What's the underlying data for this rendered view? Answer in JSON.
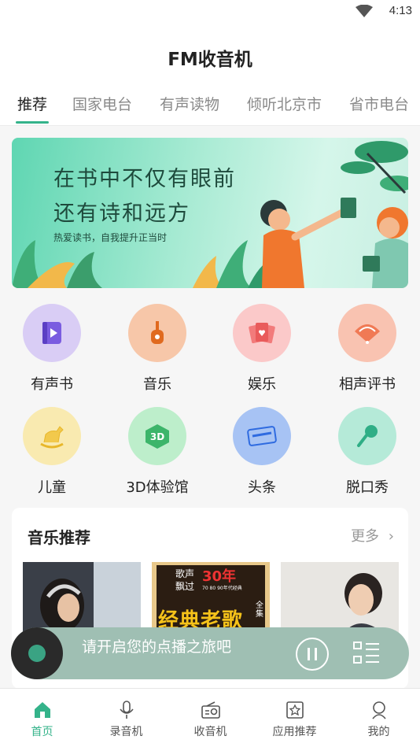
{
  "status": {
    "time": "4:13"
  },
  "header": {
    "title": "FM收音机"
  },
  "tabs": [
    {
      "label": "推荐"
    },
    {
      "label": "国家电台"
    },
    {
      "label": "有声读物"
    },
    {
      "label": "倾听北京市"
    },
    {
      "label": "省市电台"
    }
  ],
  "banner": {
    "line1": "在书中不仅有眼前",
    "line2": "还有诗和远方",
    "subtitle": "热爱读书，自我提升正当时"
  },
  "categories": [
    {
      "label": "有声书",
      "icon": "audiobook-icon",
      "color": "#d9cdf5"
    },
    {
      "label": "音乐",
      "icon": "guitar-icon",
      "color": "#f7c7a9"
    },
    {
      "label": "娱乐",
      "icon": "cards-icon",
      "color": "#fbc9c9"
    },
    {
      "label": "相声评书",
      "icon": "fan-icon",
      "color": "#f9c3b1"
    },
    {
      "label": "儿童",
      "icon": "rocking-horse-icon",
      "color": "#f9eab0"
    },
    {
      "label": "3D体验馆",
      "icon": "3d-icon",
      "color": "#bdeecb"
    },
    {
      "label": "头条",
      "icon": "news-icon",
      "color": "#a7c3f4"
    },
    {
      "label": "脱口秀",
      "icon": "microphone-icon",
      "color": "#b5ead8"
    }
  ],
  "music": {
    "title": "音乐推荐",
    "more": "更多",
    "thumb2_text1": "歌声",
    "thumb2_text2": "飘过",
    "thumb2_text3": "经典老歌",
    "thumb2_text4": "全集",
    "thumb2_year": "30年",
    "thumb2_decades": "70 80 90年代经典"
  },
  "player": {
    "text": "请开启您的点播之旅吧"
  },
  "nav": [
    {
      "label": "首页",
      "icon": "home-icon"
    },
    {
      "label": "录音机",
      "icon": "recorder-icon"
    },
    {
      "label": "收音机",
      "icon": "radio-icon"
    },
    {
      "label": "应用推荐",
      "icon": "apps-icon"
    },
    {
      "label": "我的",
      "icon": "profile-icon"
    }
  ],
  "colors": {
    "accent": "#34b38a",
    "player_bg": "#9fbfb3"
  }
}
